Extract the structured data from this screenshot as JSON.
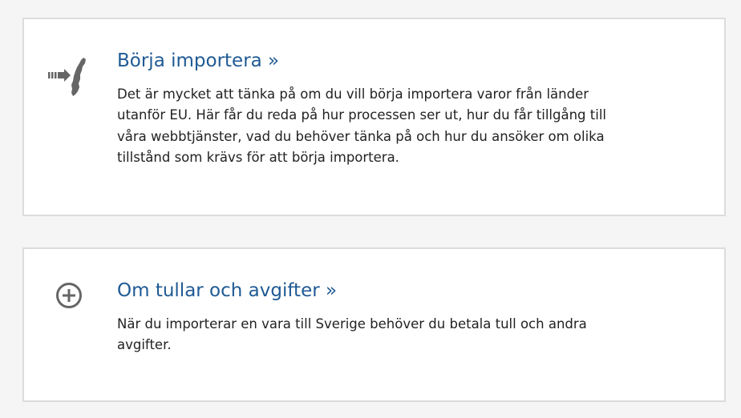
{
  "cards": [
    {
      "icon": "import-sweden-icon",
      "title": "Börja importera »",
      "text": "Det är mycket att tänka på om du vill börja importera varor från länder utanför EU. Här får du reda på hur processen ser ut, hur du får tillgång till våra webbtjänster, vad du behöver tänka på och hur du ansöker om olika tillstånd som krävs för att börja importera."
    },
    {
      "icon": "plus-circle-icon",
      "title": "Om tullar och avgifter »",
      "text": "När du importerar en vara till Sverige behöver du betala tull och andra avgifter."
    }
  ],
  "colors": {
    "link": "#1f5a94",
    "text": "#222222",
    "icon": "#666666",
    "border": "#dcdcdc",
    "background": "#f5f5f5"
  }
}
